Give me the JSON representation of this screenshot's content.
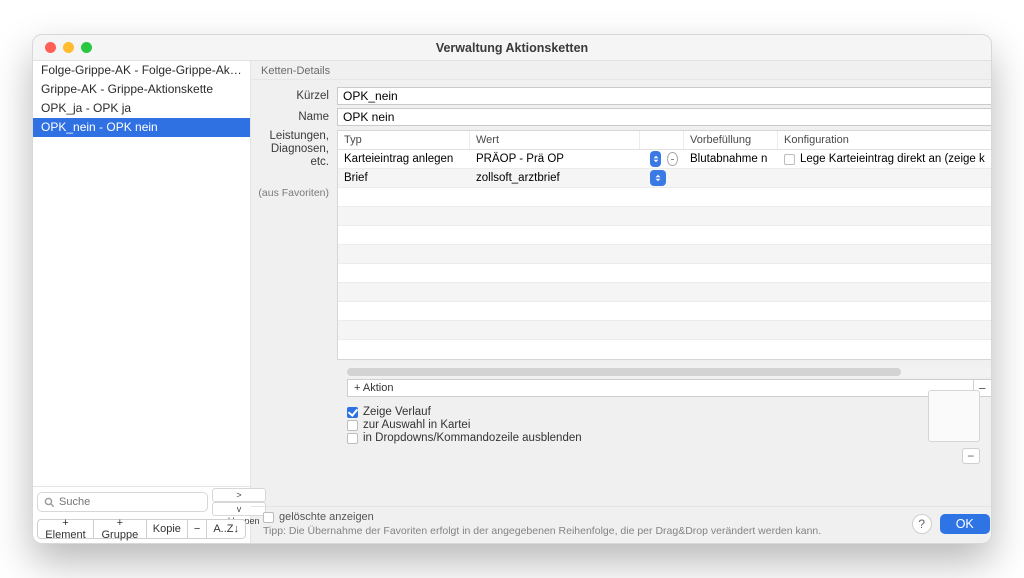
{
  "window": {
    "title": "Verwaltung Aktionsketten"
  },
  "sidebar": {
    "items": [
      {
        "label": "Folge-Grippe-AK - Folge-Grippe-Akt…"
      },
      {
        "label": "Grippe-AK - Grippe-Aktionskette"
      },
      {
        "label": "OPK_ja - OPK ja"
      },
      {
        "label": "OPK_nein - OPK nein"
      }
    ],
    "search_placeholder": "Suche",
    "expand_label": "> aufklappen",
    "collapse_label": "v zuklappen",
    "buttons": {
      "add_element": "+ Element",
      "add_group": "+ Gruppe",
      "copy": "Kopie",
      "remove": "−",
      "sort": "A..Z↓"
    }
  },
  "details": {
    "section_title": "Ketten-Details",
    "labels": {
      "kuerzel": "Kürzel",
      "name": "Name",
      "leistungen": "Leistungen,\nDiagnosen,\netc.",
      "favoriten": "(aus Favoriten)"
    },
    "values": {
      "kuerzel": "OPK_nein",
      "name": "OPK nein"
    },
    "table": {
      "columns": {
        "typ": "Typ",
        "wert": "Wert",
        "vorbefuellung": "Vorbefüllung",
        "konfiguration": "Konfiguration"
      },
      "rows": [
        {
          "typ": "Karteieintrag anlegen",
          "wert": "PRÄOP - Prä OP",
          "vorbefuellung": "Blutabnahme n",
          "konf_check": false,
          "konf_label": "Lege Karteieintrag direkt an (zeige k"
        },
        {
          "typ": "Brief",
          "wert": "zollsoft_arztbrief",
          "vorbefuellung": "",
          "konf_check": null,
          "konf_label": ""
        }
      ]
    },
    "add_action_label": "+ Aktion",
    "checkboxes": {
      "verlauf": {
        "label": "Zeige Verlauf",
        "checked": true
      },
      "auswahl": {
        "label": "zur Auswahl in Kartei",
        "checked": false
      },
      "dropdowns": {
        "label": "in Dropdowns/Kommandozeile ausblenden",
        "checked": false
      }
    }
  },
  "footer": {
    "deleted_label": "gelöschte anzeigen",
    "tip": "Tipp: Die Übernahme der Favoriten erfolgt in der angegebenen Reihenfolge, die per Drag&Drop verändert werden kann.",
    "ok": "OK"
  }
}
